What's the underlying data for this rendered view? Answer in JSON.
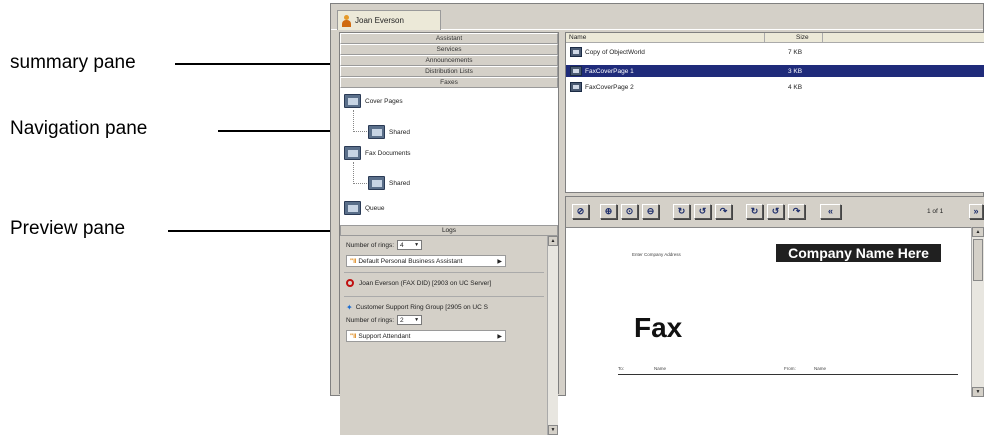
{
  "callouts": {
    "summary": "summary pane",
    "navigation": "Navigation pane",
    "preview": "Preview pane"
  },
  "app": {
    "user_tab": "Joan Everson"
  },
  "nav": {
    "buttons": [
      "Assistant",
      "Services",
      "Announcements",
      "Distribution Lists",
      "Faxes"
    ],
    "tree": {
      "cover_pages": "Cover Pages",
      "cover_shared": "Shared",
      "fax_documents": "Fax Documents",
      "fax_shared": "Shared",
      "queue": "Queue"
    },
    "logs": "Logs"
  },
  "options": {
    "rings_label_1": "Number of rings:",
    "rings_value_1": "4",
    "assistant_1": "Default Personal Business Assistant",
    "did_line": "Joan Everson (FAX DID) [2903 on UC Server]",
    "ring_group": "Customer Support Ring Group [2905 on UC S",
    "rings_label_2": "Number of rings:",
    "rings_value_2": "2",
    "assistant_2": "Support Attendant"
  },
  "files": {
    "col_name": "Name",
    "col_size": "Size",
    "rows": [
      {
        "name": "Copy of ObjectWorld",
        "size": "7 KB"
      },
      {
        "name": "FaxCoverPage 1",
        "size": "3 KB"
      },
      {
        "name": "FaxCoverPage 2",
        "size": "4 KB"
      }
    ]
  },
  "preview": {
    "page_indicator": "1 of 1",
    "company_address": "Enter Company Address",
    "company_name": "Company Name Here",
    "fax_heading": "Fax",
    "field_to": "To:",
    "field_name1": "Name",
    "field_from": "From:",
    "field_name2": "Name"
  },
  "colors": {
    "selection": "#1f2b7a",
    "chrome": "#d4d0c8"
  }
}
